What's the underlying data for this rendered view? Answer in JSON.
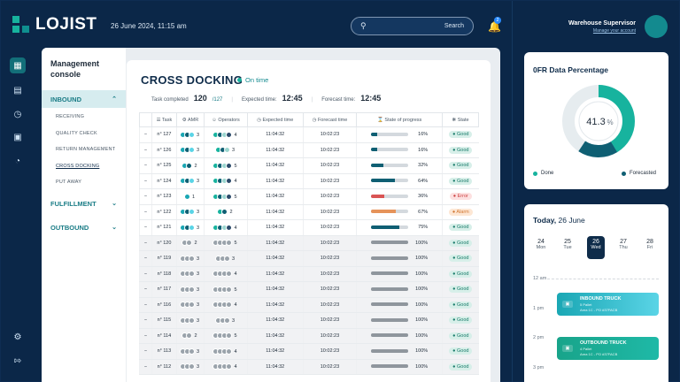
{
  "brand": {
    "name": "LOJIST"
  },
  "header": {
    "datetime": "26 June 2024, 11:15 am",
    "search_label": "Search",
    "notification_count": "2",
    "user_role": "Warehouse Supervisor",
    "user_account_link": "Manage your account"
  },
  "sidebar": {
    "title_line1": "Management",
    "title_line2": "console",
    "sections": [
      {
        "label": "INBOUND",
        "open": true
      },
      {
        "label": "FULFILLMENT",
        "open": false
      },
      {
        "label": "OUTBOUND",
        "open": false
      }
    ],
    "inbound_items": [
      "RECEIVING",
      "QUALITY CHECK",
      "RETURN MANAGEMENT",
      "CROSS DOCKING",
      "PUT AWAY"
    ]
  },
  "main": {
    "title": "CROSS DOCKING",
    "status": "On time",
    "task_completed_label": "Task completed",
    "task_completed_value": "120",
    "task_total": "/127",
    "expected_label": "Expected time:",
    "expected_value": "12:45",
    "forecast_label": "Forecast time:",
    "forecast_value": "12:45",
    "columns": [
      "Task",
      "AMR",
      "Operators",
      "Expected time",
      "Forecast time",
      "State of progress",
      "State"
    ],
    "rows": [
      {
        "task": "n° 127",
        "amr": "3",
        "ops": "4",
        "expected": "11:04:32",
        "forecast": "10:02:23",
        "progress": "16%",
        "p": 16,
        "state": "Good",
        "kind": "good",
        "done": false
      },
      {
        "task": "n° 126",
        "amr": "3",
        "ops": "3",
        "expected": "11:04:32",
        "forecast": "10:02:23",
        "progress": "16%",
        "p": 16,
        "state": "Good",
        "kind": "good",
        "done": false
      },
      {
        "task": "n° 125",
        "amr": "2",
        "ops": "5",
        "expected": "11:04:32",
        "forecast": "10:02:23",
        "progress": "32%",
        "p": 32,
        "state": "Good",
        "kind": "good",
        "done": false
      },
      {
        "task": "n° 124",
        "amr": "3",
        "ops": "4",
        "expected": "11:04:32",
        "forecast": "10:02:23",
        "progress": "64%",
        "p": 64,
        "state": "Good",
        "kind": "good",
        "done": false
      },
      {
        "task": "n° 123",
        "amr": "1",
        "ops": "5",
        "expected": "11:04:32",
        "forecast": "10:02:23",
        "progress": "36%",
        "p": 36,
        "state": "Error",
        "kind": "error",
        "done": false
      },
      {
        "task": "n° 122",
        "amr": "3",
        "ops": "2",
        "expected": "11:04:32",
        "forecast": "10:02:23",
        "progress": "67%",
        "p": 67,
        "state": "Alarm",
        "kind": "alarm",
        "done": false
      },
      {
        "task": "n° 121",
        "amr": "3",
        "ops": "4",
        "expected": "11:04:32",
        "forecast": "10:02:23",
        "progress": "75%",
        "p": 75,
        "state": "Good",
        "kind": "good",
        "done": false
      },
      {
        "task": "n° 120",
        "amr": "2",
        "ops": "5",
        "expected": "11:04:32",
        "forecast": "10:02:23",
        "progress": "100%",
        "p": 100,
        "state": "Good",
        "kind": "good",
        "done": true
      },
      {
        "task": "n° 119",
        "amr": "3",
        "ops": "3",
        "expected": "11:04:32",
        "forecast": "10:02:23",
        "progress": "100%",
        "p": 100,
        "state": "Good",
        "kind": "good",
        "done": true
      },
      {
        "task": "n° 118",
        "amr": "3",
        "ops": "4",
        "expected": "11:04:32",
        "forecast": "10:02:23",
        "progress": "100%",
        "p": 100,
        "state": "Good",
        "kind": "good",
        "done": true
      },
      {
        "task": "n° 117",
        "amr": "3",
        "ops": "5",
        "expected": "11:04:32",
        "forecast": "10:02:23",
        "progress": "100%",
        "p": 100,
        "state": "Good",
        "kind": "good",
        "done": true
      },
      {
        "task": "n° 116",
        "amr": "3",
        "ops": "4",
        "expected": "11:04:32",
        "forecast": "10:02:23",
        "progress": "100%",
        "p": 100,
        "state": "Good",
        "kind": "good",
        "done": true
      },
      {
        "task": "n° 115",
        "amr": "3",
        "ops": "3",
        "expected": "11:04:32",
        "forecast": "10:02:23",
        "progress": "100%",
        "p": 100,
        "state": "Good",
        "kind": "good",
        "done": true
      },
      {
        "task": "n° 114",
        "amr": "2",
        "ops": "5",
        "expected": "11:04:32",
        "forecast": "10:02:23",
        "progress": "100%",
        "p": 100,
        "state": "Good",
        "kind": "good",
        "done": true
      },
      {
        "task": "n° 113",
        "amr": "3",
        "ops": "4",
        "expected": "11:04:32",
        "forecast": "10:02:23",
        "progress": "100%",
        "p": 100,
        "state": "Good",
        "kind": "good",
        "done": true
      },
      {
        "task": "n° 112",
        "amr": "3",
        "ops": "4",
        "expected": "11:04:32",
        "forecast": "10:02:23",
        "progress": "100%",
        "p": 100,
        "state": "Good",
        "kind": "good",
        "done": true
      }
    ]
  },
  "ofr": {
    "title": "0FR Data Percentage",
    "value": "41.3",
    "unit": "%",
    "done_fraction": 0.413,
    "legend_done": "Done",
    "legend_forecasted": "Forecasted"
  },
  "today": {
    "title_prefix": "Today,",
    "title_date": "26 June",
    "days": [
      {
        "num": "24",
        "name": "Mon",
        "today": false
      },
      {
        "num": "25",
        "name": "Tue",
        "today": false
      },
      {
        "num": "26",
        "name": "Wed",
        "today": true
      },
      {
        "num": "27",
        "name": "Thu",
        "today": false
      },
      {
        "num": "28",
        "name": "Fri",
        "today": false
      }
    ],
    "times": [
      "12 am",
      "1 pm",
      "2 pm",
      "3 pm"
    ],
    "events": [
      {
        "title": "INBOUND TRUCK",
        "line1": "5 Pallet",
        "line2": "Area 1C - PO #37FACB"
      },
      {
        "title": "OUTBOUND TRUCK",
        "line1": "4 Pallet",
        "line2": "Area 1C - PO #37FACB"
      }
    ]
  },
  "colors": {
    "accent": "#138a8f",
    "navy": "#0b2748",
    "done": "#17b39e",
    "forecast": "#0f5f73"
  }
}
